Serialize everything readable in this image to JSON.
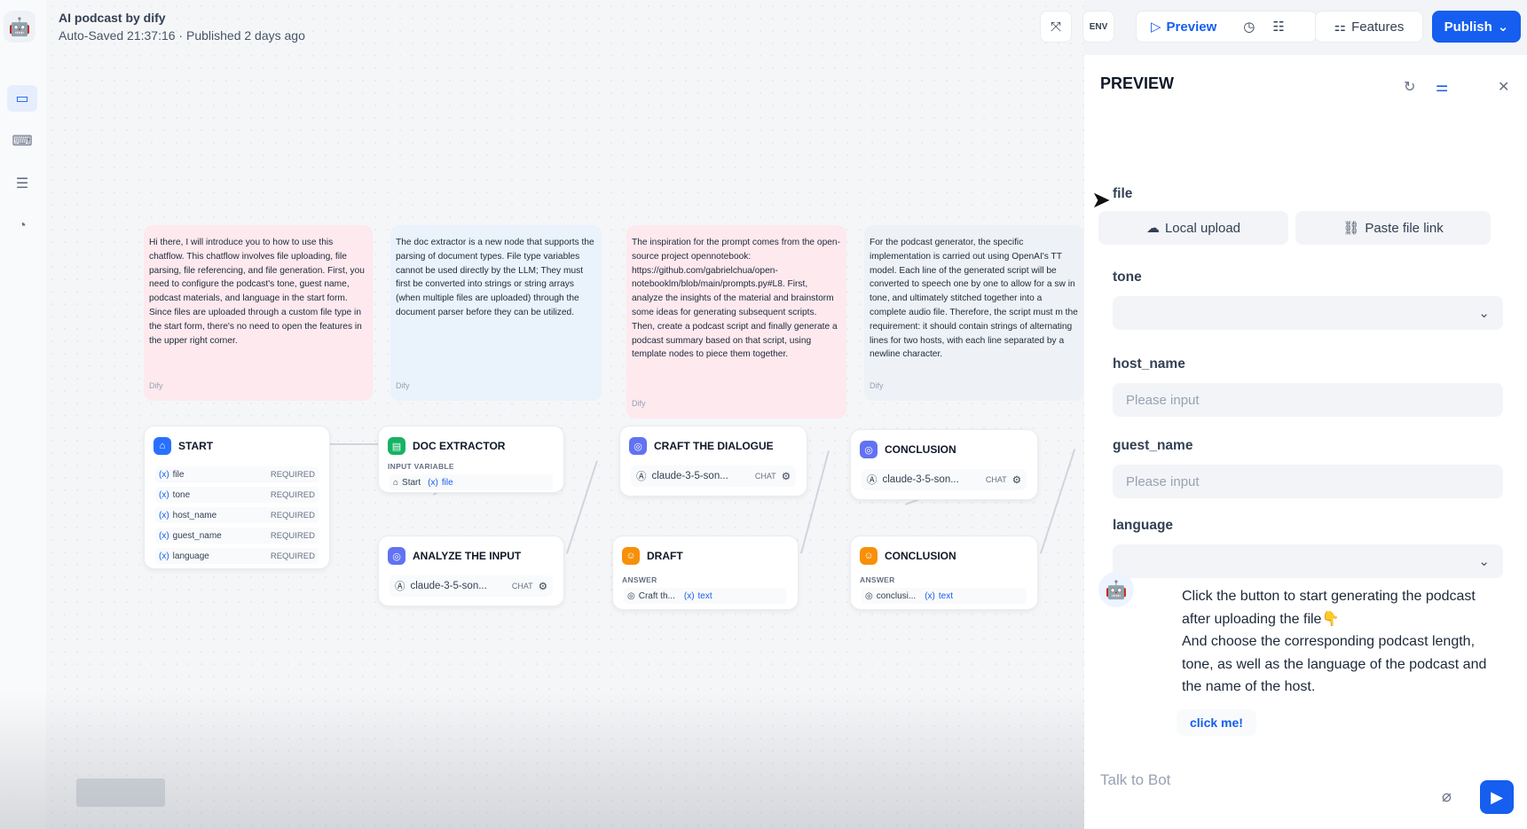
{
  "app": {
    "title": "AI podcast by dify",
    "meta": "Auto-Saved 21:37:16 · Published 2 days ago"
  },
  "toolbar": {
    "env_label": "ENV",
    "preview_label": "Preview",
    "features_label": "Features",
    "publish_label": "Publish",
    "accent_color": "#155eef"
  },
  "notes": [
    {
      "text": "Hi there, I will introduce you to how to use this chatflow. This chatflow involves file uploading, file parsing, file referencing, and file generation. First, you need to configure the podcast's tone, guest name, podcast materials, and language in the start form. Since files are uploaded through a custom file type in the start form, there's no need to open the features in the upper right corner.",
      "source": "Dify",
      "color": "#fde9ee"
    },
    {
      "text": "The doc extractor is a new node that supports the parsing of document types. File type variables cannot be used directly by the LLM; They must first be converted into strings or string arrays (when multiple files are uploaded) through the document parser before they can be utilized.",
      "source": "Dify",
      "color": "#eaf2fc"
    },
    {
      "text": "The inspiration for the prompt comes from the open-source project opennotebook: https://github.com/gabrielchua/open-notebooklm/blob/main/prompts.py#L8. First, analyze the insights of the material and brainstorm some ideas for generating subsequent scripts. Then, create a podcast script and finally generate a podcast summary based on that script, using template nodes to piece them together.",
      "source": "Dify",
      "color": "#fde9ee"
    },
    {
      "text": "For the podcast generator, the specific implementation is carried out using OpenAI's TT model. Each line of the generated script will be converted to speech one by one to allow for a sw in tone, and ultimately stitched together into a complete audio file. Therefore, the script must m the requirement: it should contain strings of alternating lines for two hosts, with each line separated by a newline character.",
      "source": "Dify",
      "color": "#eef2f6"
    }
  ],
  "nodes": {
    "start": {
      "title": "START",
      "vars": [
        {
          "name": "file",
          "tag": "REQUIRED"
        },
        {
          "name": "tone",
          "tag": "REQUIRED"
        },
        {
          "name": "host_name",
          "tag": "REQUIRED"
        },
        {
          "name": "guest_name",
          "tag": "REQUIRED"
        },
        {
          "name": "language",
          "tag": "REQUIRED"
        }
      ]
    },
    "doc_extractor": {
      "title": "DOC EXTRACTOR",
      "label": "INPUT VARIABLE",
      "src": "Start",
      "var": "file"
    },
    "analyze": {
      "title": "ANALYZE THE INPUT",
      "model": "claude-3-5-son...",
      "mode": "CHAT"
    },
    "craft": {
      "title": "CRAFT THE DIALOGUE",
      "model": "claude-3-5-son...",
      "mode": "CHAT"
    },
    "draft": {
      "title": "DRAFT",
      "label": "ANSWER",
      "src": "Craft th...",
      "var": "text"
    },
    "conclusion1": {
      "title": "CONCLUSION",
      "model": "claude-3-5-son...",
      "mode": "CHAT"
    },
    "conclusion2": {
      "title": "CONCLUSION",
      "label": "ANSWER",
      "src": "conclusi...",
      "var": "text"
    }
  },
  "var_prefix": "(x)",
  "preview": {
    "title": "PREVIEW",
    "fields": {
      "file_label": "file",
      "local_upload": "Local upload",
      "paste_link": "Paste file link",
      "tone_label": "tone",
      "host_label": "host_name",
      "host_placeholder": "Please input",
      "guest_label": "guest_name",
      "guest_placeholder": "Please input",
      "language_label": "language"
    },
    "message": "Click the button to start generating the podcast after uploading the file👇\nAnd choose the corresponding podcast length, tone, as well as the language of the podcast and the name of the host.",
    "click_me": "click me!",
    "input_placeholder": "Talk to Bot"
  }
}
